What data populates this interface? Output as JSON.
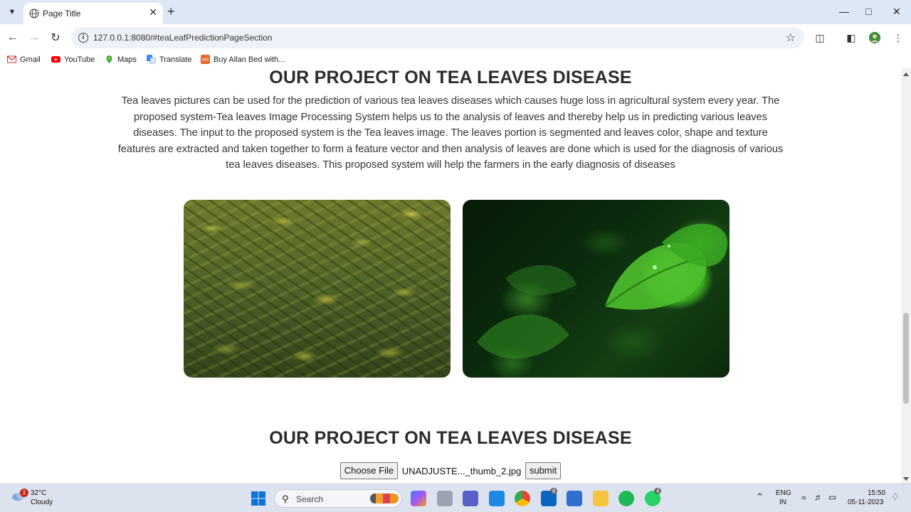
{
  "browser": {
    "tab_title": "Page Title",
    "url": "127.0.0.1:8080/#teaLeafPredictionPageSection",
    "bookmarks": [
      "Gmail",
      "YouTube",
      "Maps",
      "Translate",
      "Buy Allan Bed with..."
    ]
  },
  "page": {
    "section1": {
      "heading": "OUR PROJECT ON TEA LEAVES DISEASE",
      "paragraph": "Tea leaves pictures can be used for the prediction of various tea leaves diseases which causes huge loss in agricultural system every year. The proposed system-Tea leaves Image Processing System helps us to the analysis of leaves and thereby help us in predicting various leaves diseases. The input to the proposed system is the Tea leaves image. The leaves portion is segmented and leaves color, shape and texture features are extracted and taken together to form a feature vector and then analysis of leaves are done which is used for the diagnosis of various tea leaves diseases. This proposed system will help the farmers in the early diagnosis of diseases"
    },
    "section2": {
      "heading": "OUR PROJECT ON TEA LEAVES DISEASE",
      "choose_file_label": "Choose File",
      "file_name": "UNADJUSTE..._thumb_2.jpg",
      "submit_label": "submit"
    }
  },
  "taskbar": {
    "weather_badge": "1",
    "temperature": "32°C",
    "weather": "Cloudy",
    "search_label": "Search",
    "teams_badge": "6",
    "whatsapp_badge": "4",
    "language": "ENG",
    "region": "IN",
    "time": "15:50",
    "date": "05-11-2023"
  },
  "colors": {
    "tabstrip": "#dee7f6",
    "taskbar": "#dde3ee",
    "heading_text": "#2b2b2b"
  }
}
